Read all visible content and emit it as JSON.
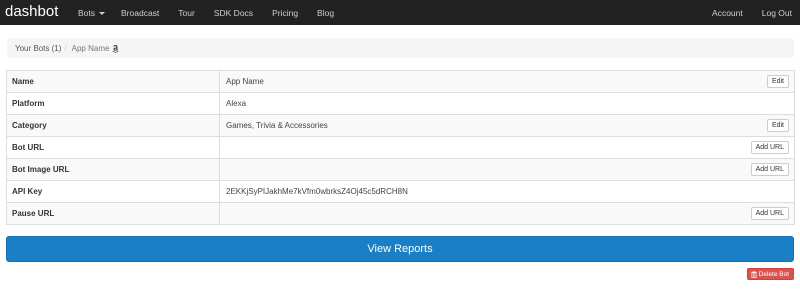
{
  "navbar": {
    "brand": "dashbot",
    "left_items": [
      {
        "label": "Bots"
      },
      {
        "label": "Broadcast"
      },
      {
        "label": "Tour"
      },
      {
        "label": "SDK Docs"
      },
      {
        "label": "Pricing"
      },
      {
        "label": "Blog"
      }
    ],
    "right_items": [
      {
        "label": "Account"
      },
      {
        "label": "Log Out"
      }
    ]
  },
  "breadcrumb": {
    "parent": "Your Bots (1)",
    "separator": "/",
    "current": "App Name",
    "icon": "amazon-icon"
  },
  "properties": [
    {
      "key": "Name",
      "value": "App Name",
      "action": "Edit"
    },
    {
      "key": "Platform",
      "value": "Alexa",
      "action": ""
    },
    {
      "key": "Category",
      "value": "Games, Trivia & Accessories",
      "action": "Edit"
    },
    {
      "key": "Bot URL",
      "value": "",
      "action": "Add URL"
    },
    {
      "key": "Bot Image URL",
      "value": "",
      "action": "Add URL"
    },
    {
      "key": "API Key",
      "value": "2EKKjSyPIJakhMe7kVfm0wbrksZ4Oj45c5dRCH8N",
      "action": ""
    },
    {
      "key": "Pause URL",
      "value": "",
      "action": "Add URL"
    }
  ],
  "view_reports_label": "View Reports",
  "delete_label": "Delete Bot",
  "colors": {
    "navbar": "#222222",
    "primary": "#1a7fc4",
    "danger": "#d9534f"
  }
}
